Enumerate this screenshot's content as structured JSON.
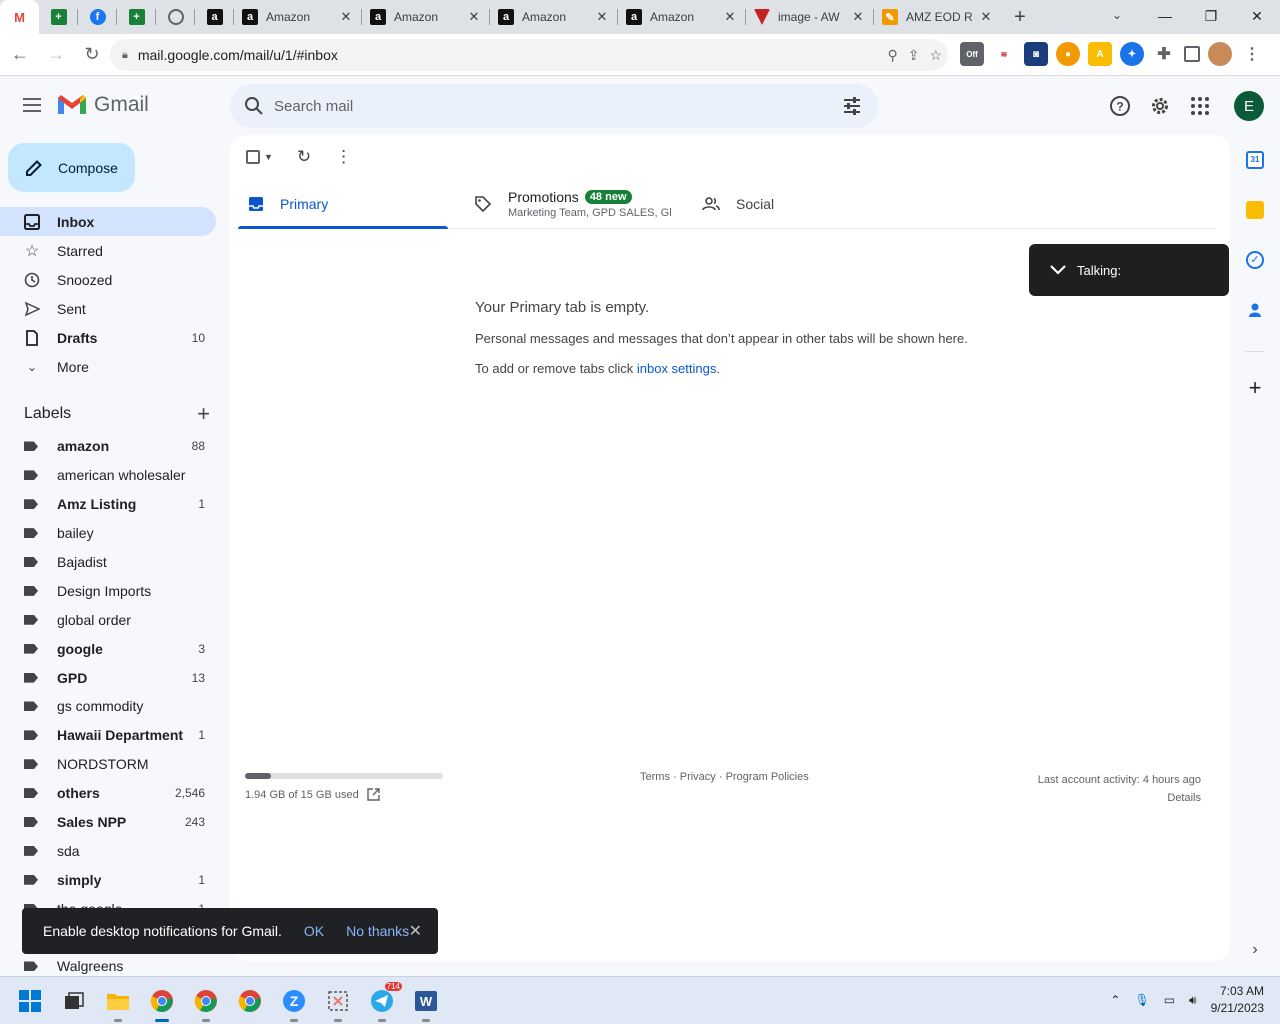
{
  "browser": {
    "tabs": [
      {
        "title": "Amazon",
        "icon": "amazon-icon"
      },
      {
        "title": "Amazon",
        "icon": "amazon-icon"
      },
      {
        "title": "Amazon",
        "icon": "amazon-icon"
      },
      {
        "title": "Amazon",
        "icon": "amazon-icon"
      },
      {
        "title": "image - AW",
        "icon": "image-icon"
      },
      {
        "title": "AMZ EOD R",
        "icon": "pencil-icon"
      }
    ],
    "url": "mail.google.com/mail/u/1/#inbox"
  },
  "header": {
    "app_name": "Gmail",
    "search_placeholder": "Search mail",
    "user_initial": "E"
  },
  "compose_label": "Compose",
  "nav": [
    {
      "label": "Inbox",
      "count": ""
    },
    {
      "label": "Starred",
      "count": ""
    },
    {
      "label": "Snoozed",
      "count": ""
    },
    {
      "label": "Sent",
      "count": ""
    },
    {
      "label": "Drafts",
      "count": "10"
    },
    {
      "label": "More",
      "count": ""
    }
  ],
  "labels_title": "Labels",
  "labels": [
    {
      "name": "amazon",
      "count": "88"
    },
    {
      "name": "american wholesaler",
      "count": ""
    },
    {
      "name": "Amz Listing",
      "count": "1"
    },
    {
      "name": "bailey",
      "count": ""
    },
    {
      "name": "Bajadist",
      "count": ""
    },
    {
      "name": "Design Imports",
      "count": ""
    },
    {
      "name": "global order",
      "count": ""
    },
    {
      "name": "google",
      "count": "3"
    },
    {
      "name": "GPD",
      "count": "13"
    },
    {
      "name": "gs commodity",
      "count": ""
    },
    {
      "name": "Hawaii Department",
      "count": "1"
    },
    {
      "name": "NORDSTORM",
      "count": ""
    },
    {
      "name": "others",
      "count": "2,546"
    },
    {
      "name": "Sales NPP",
      "count": "243"
    },
    {
      "name": "sda",
      "count": ""
    },
    {
      "name": "simply",
      "count": "1"
    },
    {
      "name": "the google",
      "count": "1"
    },
    {
      "name": "",
      "count": ""
    },
    {
      "name": "Walgreens",
      "count": ""
    }
  ],
  "inbox_tabs": {
    "primary": "Primary",
    "promotions": "Promotions",
    "promotions_badge": "48 new",
    "promotions_senders": "Marketing Team, GPD SALES, Gl...",
    "social": "Social"
  },
  "empty_state": {
    "heading": "Your Primary tab is empty.",
    "line1": "Personal messages and messages that don’t appear in other tabs will be shown here.",
    "line2_prefix": "To add or remove tabs click ",
    "line2_link": "inbox settings",
    "line2_suffix": "."
  },
  "talking_label": "Talking:",
  "footer": {
    "storage_used_fraction": 0.13,
    "storage_text": "1.94 GB of 15 GB used",
    "terms": "Terms",
    "privacy": "Privacy",
    "program_policies": "Program Policies",
    "activity": "Last account activity: 4 hours ago",
    "details": "Details"
  },
  "toast": {
    "message": "Enable desktop notifications for Gmail.",
    "ok": "OK",
    "no_thanks": "No thanks"
  },
  "taskbar": {
    "time": "7:03 AM",
    "date": "9/21/2023",
    "telegram_badge": "714"
  }
}
